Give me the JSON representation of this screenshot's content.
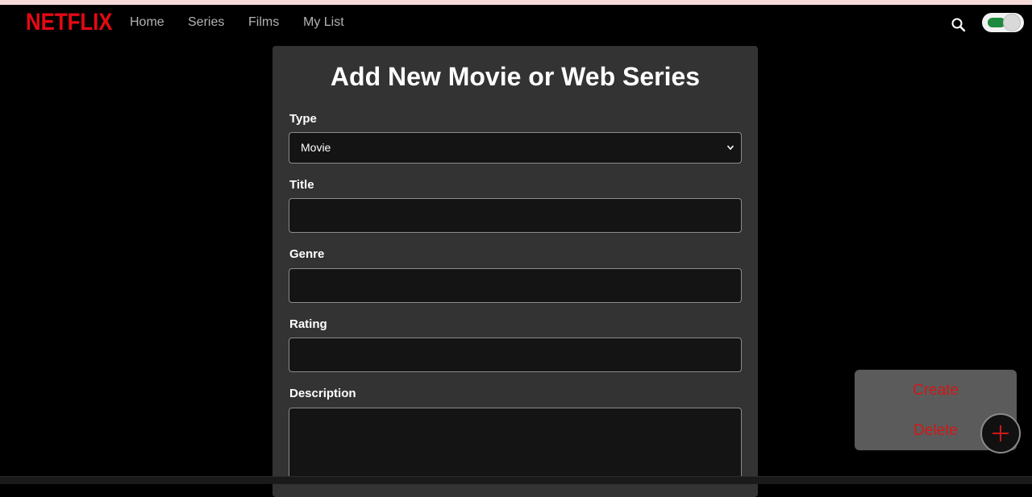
{
  "nav": {
    "logo": "NETFLIX",
    "links": [
      "Home",
      "Series",
      "Films",
      "My List"
    ],
    "search_icon": "search-icon",
    "toggle_state": "on"
  },
  "form": {
    "title": "Add New Movie or Web Series",
    "type": {
      "label": "Type",
      "value": "Movie"
    },
    "title_field": {
      "label": "Title",
      "value": ""
    },
    "genre": {
      "label": "Genre",
      "value": ""
    },
    "rating": {
      "label": "Rating",
      "value": ""
    },
    "description": {
      "label": "Description",
      "value": ""
    }
  },
  "actions": {
    "create": "Create",
    "delete": "Delete",
    "fab_icon": "plus-icon"
  },
  "colors": {
    "brand": "#e50914",
    "action_text": "#d01818",
    "card_bg": "#333333",
    "toggle_on": "#1f8a3f"
  }
}
